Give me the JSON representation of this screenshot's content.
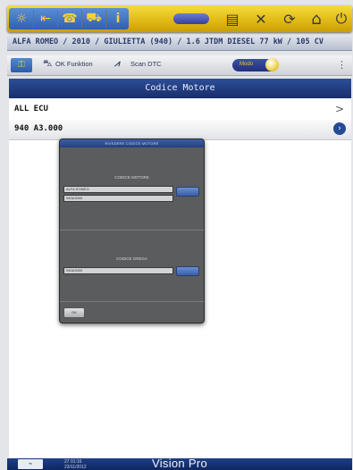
{
  "toolbar": {
    "left_icons": [
      "brightness-icon",
      "back-icon",
      "phone-icon",
      "vehicle-icon",
      "info-icon"
    ],
    "right_icons": [
      "printer-icon",
      "tools-icon",
      "refresh-icon",
      "home-icon",
      "power-icon"
    ],
    "glyphs": {
      "brightness": "☼",
      "back": "⇤",
      "phone": "☎",
      "vehicle": "⛟",
      "info": "i",
      "printer": "▤",
      "tools": "✕",
      "refresh": "⟳",
      "home": "⌂",
      "power": "⏻"
    }
  },
  "vehicle": {
    "text": "ALFA ROMEO / 2010 / GIULIETTA (940) / 1.6 JTDM DIESEL 77 kW / 105 CV"
  },
  "subbar": {
    "ok_function": "OK Funktion",
    "scan_dtc": "Scan DTC",
    "toggle_label": "Modo"
  },
  "panel": {
    "title": "Codice Motore",
    "rows": [
      "ALL ECU",
      "940 A3.000"
    ]
  },
  "dialog": {
    "title": "RIVEDERE CODICE MOTORE",
    "section1_label": "CODICE MOTORE",
    "field1_value": "ALFA ROMEO",
    "field2_value": "940A3000",
    "section2_label": "CODICE GREGA",
    "field3_value": "940A3000",
    "ok_label": "OK"
  },
  "bottom": {
    "status_line1": "27 01:16",
    "status_line2": "23/11/2012",
    "brand": "Vision Pro"
  },
  "colors": {
    "toolbar_yellow": "#e0b814",
    "brand_blue": "#1e3f88",
    "panel_title_blue": "#2e4e98"
  }
}
